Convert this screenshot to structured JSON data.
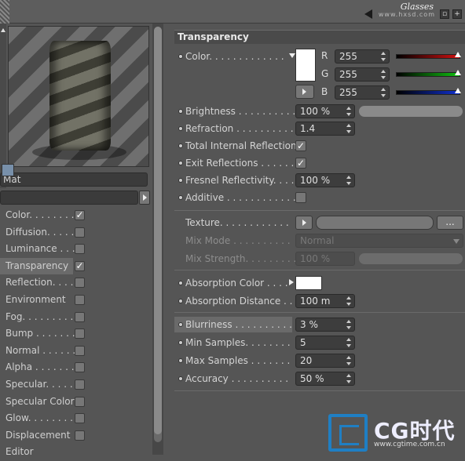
{
  "watermark_top": {
    "logo": "Glasses",
    "url": "www.hxsd.com"
  },
  "material": {
    "name": "Mat"
  },
  "channels": [
    {
      "label": "Color. . . . . . . .",
      "checked": true
    },
    {
      "label": "Diffusion. . . . . .",
      "checked": false
    },
    {
      "label": "Luminance . . . .",
      "checked": false
    },
    {
      "label": "Transparency",
      "checked": true,
      "selected": true
    },
    {
      "label": "Reflection. . . . .",
      "checked": false
    },
    {
      "label": "Environment",
      "checked": false
    },
    {
      "label": "Fog. . . . . . . . .",
      "checked": false
    },
    {
      "label": "Bump . . . . . . .",
      "checked": false
    },
    {
      "label": "Normal . . . . . .",
      "checked": false
    },
    {
      "label": "Alpha . . . . . . .",
      "checked": false
    },
    {
      "label": "Specular. . . . . .",
      "checked": false
    },
    {
      "label": "Specular Color",
      "checked": false
    },
    {
      "label": "Glow. . . . . . . .",
      "checked": false
    },
    {
      "label": "Displacement",
      "checked": false
    },
    {
      "label": "Editor",
      "checked": false
    }
  ],
  "transparency": {
    "title": "Transparency",
    "color_label": "Color. . . . . . . . . . . . .",
    "r_label": "R",
    "g_label": "G",
    "b_label": "B",
    "r": "255",
    "g": "255",
    "b": "255",
    "swatch": "#ffffff",
    "brightness_label": "Brightness . . . . . . . . . .",
    "brightness": "100 %",
    "brightness_level": 1.0,
    "refraction_label": "Refraction . . . . . . . . . .",
    "refraction": "1.4",
    "tir_label": "Total Internal Reflection",
    "tir_mark": "✓",
    "exit_label": "Exit Reflections . . . . . .",
    "exit_mark": "✓",
    "fresnel_label": "Fresnel Reflectivity. . . .",
    "fresnel": "100 %",
    "additive_label": "Additive . . . . . . . . . . . .",
    "texture_label": "Texture. . . . . . . . . . . .",
    "texture_more": "...",
    "mixmode_label": "Mix Mode . . . . . . . . . .",
    "mixmode": "Normal",
    "mixstrength_label": "Mix Strength. . . . . . . . .",
    "mixstrength": "100 %",
    "absorption_color_label": "Absorption Color . . . .",
    "absorption_distance_label": "Absorption Distance . . .",
    "absorption_distance": "100 m",
    "blurriness_label": "Blurriness . . . . . . . . . .",
    "blurriness": "3 %",
    "min_samples_label": "Min Samples. . . . . . . .",
    "min_samples": "5",
    "max_samples_label": "Max Samples . . . . . . .",
    "max_samples": "20",
    "accuracy_label": "Accuracy . . . . . . . . . .",
    "accuracy": "50 %"
  },
  "watermark_bottom": {
    "brand": "CG时代",
    "url": "www.cgtime.com.cn"
  },
  "colors": {
    "red": "#d01010",
    "green": "#10c010",
    "blue": "#1030d0",
    "accent": "#1f7fc4"
  }
}
